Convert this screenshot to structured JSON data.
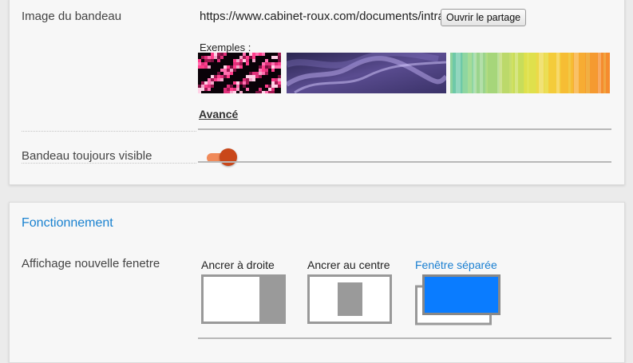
{
  "banner_image": {
    "label": "Image du bandeau",
    "url": "https://www.cabinet-roux.com/documents/intra",
    "share_button": "Ouvrir le partage",
    "examples_label": "Exemples :",
    "examples": [
      {
        "name": "pink-pixels"
      },
      {
        "name": "purple-smoke"
      },
      {
        "name": "color-stripes"
      }
    ],
    "advanced_link": "Avancé"
  },
  "banner_always_visible": {
    "label": "Bandeau toujours visible",
    "enabled": true,
    "toggle_track_color": "#f08a5a",
    "toggle_knob_color": "#c9471a"
  },
  "operation": {
    "title": "Fonctionnement",
    "title_color": "#1a82d0",
    "window_display": {
      "label": "Affichage nouvelle fenetre",
      "selected": "Fenêtre séparée",
      "options": [
        {
          "label": "Ancrer à droite",
          "active": false
        },
        {
          "label": "Ancrer au centre",
          "active": false
        },
        {
          "label": "Fenêtre séparée",
          "active": true,
          "color": "#0a7cff"
        }
      ]
    }
  }
}
